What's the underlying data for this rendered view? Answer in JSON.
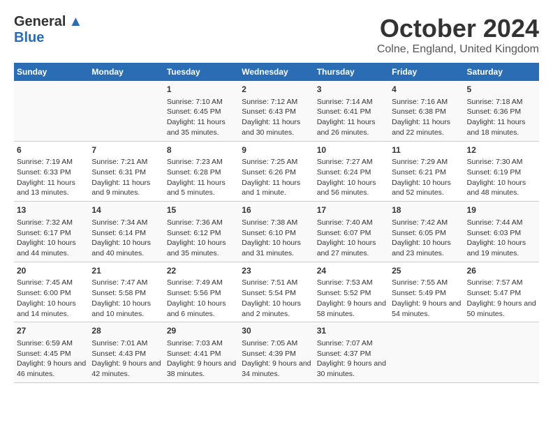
{
  "header": {
    "logo_general": "General",
    "logo_blue": "Blue",
    "month_title": "October 2024",
    "location": "Colne, England, United Kingdom"
  },
  "days_of_week": [
    "Sunday",
    "Monday",
    "Tuesday",
    "Wednesday",
    "Thursday",
    "Friday",
    "Saturday"
  ],
  "weeks": [
    [
      {
        "day": "",
        "sunrise": "",
        "sunset": "",
        "daylight": ""
      },
      {
        "day": "",
        "sunrise": "",
        "sunset": "",
        "daylight": ""
      },
      {
        "day": "1",
        "sunrise": "Sunrise: 7:10 AM",
        "sunset": "Sunset: 6:45 PM",
        "daylight": "Daylight: 11 hours and 35 minutes."
      },
      {
        "day": "2",
        "sunrise": "Sunrise: 7:12 AM",
        "sunset": "Sunset: 6:43 PM",
        "daylight": "Daylight: 11 hours and 30 minutes."
      },
      {
        "day": "3",
        "sunrise": "Sunrise: 7:14 AM",
        "sunset": "Sunset: 6:41 PM",
        "daylight": "Daylight: 11 hours and 26 minutes."
      },
      {
        "day": "4",
        "sunrise": "Sunrise: 7:16 AM",
        "sunset": "Sunset: 6:38 PM",
        "daylight": "Daylight: 11 hours and 22 minutes."
      },
      {
        "day": "5",
        "sunrise": "Sunrise: 7:18 AM",
        "sunset": "Sunset: 6:36 PM",
        "daylight": "Daylight: 11 hours and 18 minutes."
      }
    ],
    [
      {
        "day": "6",
        "sunrise": "Sunrise: 7:19 AM",
        "sunset": "Sunset: 6:33 PM",
        "daylight": "Daylight: 11 hours and 13 minutes."
      },
      {
        "day": "7",
        "sunrise": "Sunrise: 7:21 AM",
        "sunset": "Sunset: 6:31 PM",
        "daylight": "Daylight: 11 hours and 9 minutes."
      },
      {
        "day": "8",
        "sunrise": "Sunrise: 7:23 AM",
        "sunset": "Sunset: 6:28 PM",
        "daylight": "Daylight: 11 hours and 5 minutes."
      },
      {
        "day": "9",
        "sunrise": "Sunrise: 7:25 AM",
        "sunset": "Sunset: 6:26 PM",
        "daylight": "Daylight: 11 hours and 1 minute."
      },
      {
        "day": "10",
        "sunrise": "Sunrise: 7:27 AM",
        "sunset": "Sunset: 6:24 PM",
        "daylight": "Daylight: 10 hours and 56 minutes."
      },
      {
        "day": "11",
        "sunrise": "Sunrise: 7:29 AM",
        "sunset": "Sunset: 6:21 PM",
        "daylight": "Daylight: 10 hours and 52 minutes."
      },
      {
        "day": "12",
        "sunrise": "Sunrise: 7:30 AM",
        "sunset": "Sunset: 6:19 PM",
        "daylight": "Daylight: 10 hours and 48 minutes."
      }
    ],
    [
      {
        "day": "13",
        "sunrise": "Sunrise: 7:32 AM",
        "sunset": "Sunset: 6:17 PM",
        "daylight": "Daylight: 10 hours and 44 minutes."
      },
      {
        "day": "14",
        "sunrise": "Sunrise: 7:34 AM",
        "sunset": "Sunset: 6:14 PM",
        "daylight": "Daylight: 10 hours and 40 minutes."
      },
      {
        "day": "15",
        "sunrise": "Sunrise: 7:36 AM",
        "sunset": "Sunset: 6:12 PM",
        "daylight": "Daylight: 10 hours and 35 minutes."
      },
      {
        "day": "16",
        "sunrise": "Sunrise: 7:38 AM",
        "sunset": "Sunset: 6:10 PM",
        "daylight": "Daylight: 10 hours and 31 minutes."
      },
      {
        "day": "17",
        "sunrise": "Sunrise: 7:40 AM",
        "sunset": "Sunset: 6:07 PM",
        "daylight": "Daylight: 10 hours and 27 minutes."
      },
      {
        "day": "18",
        "sunrise": "Sunrise: 7:42 AM",
        "sunset": "Sunset: 6:05 PM",
        "daylight": "Daylight: 10 hours and 23 minutes."
      },
      {
        "day": "19",
        "sunrise": "Sunrise: 7:44 AM",
        "sunset": "Sunset: 6:03 PM",
        "daylight": "Daylight: 10 hours and 19 minutes."
      }
    ],
    [
      {
        "day": "20",
        "sunrise": "Sunrise: 7:45 AM",
        "sunset": "Sunset: 6:00 PM",
        "daylight": "Daylight: 10 hours and 14 minutes."
      },
      {
        "day": "21",
        "sunrise": "Sunrise: 7:47 AM",
        "sunset": "Sunset: 5:58 PM",
        "daylight": "Daylight: 10 hours and 10 minutes."
      },
      {
        "day": "22",
        "sunrise": "Sunrise: 7:49 AM",
        "sunset": "Sunset: 5:56 PM",
        "daylight": "Daylight: 10 hours and 6 minutes."
      },
      {
        "day": "23",
        "sunrise": "Sunrise: 7:51 AM",
        "sunset": "Sunset: 5:54 PM",
        "daylight": "Daylight: 10 hours and 2 minutes."
      },
      {
        "day": "24",
        "sunrise": "Sunrise: 7:53 AM",
        "sunset": "Sunset: 5:52 PM",
        "daylight": "Daylight: 9 hours and 58 minutes."
      },
      {
        "day": "25",
        "sunrise": "Sunrise: 7:55 AM",
        "sunset": "Sunset: 5:49 PM",
        "daylight": "Daylight: 9 hours and 54 minutes."
      },
      {
        "day": "26",
        "sunrise": "Sunrise: 7:57 AM",
        "sunset": "Sunset: 5:47 PM",
        "daylight": "Daylight: 9 hours and 50 minutes."
      }
    ],
    [
      {
        "day": "27",
        "sunrise": "Sunrise: 6:59 AM",
        "sunset": "Sunset: 4:45 PM",
        "daylight": "Daylight: 9 hours and 46 minutes."
      },
      {
        "day": "28",
        "sunrise": "Sunrise: 7:01 AM",
        "sunset": "Sunset: 4:43 PM",
        "daylight": "Daylight: 9 hours and 42 minutes."
      },
      {
        "day": "29",
        "sunrise": "Sunrise: 7:03 AM",
        "sunset": "Sunset: 4:41 PM",
        "daylight": "Daylight: 9 hours and 38 minutes."
      },
      {
        "day": "30",
        "sunrise": "Sunrise: 7:05 AM",
        "sunset": "Sunset: 4:39 PM",
        "daylight": "Daylight: 9 hours and 34 minutes."
      },
      {
        "day": "31",
        "sunrise": "Sunrise: 7:07 AM",
        "sunset": "Sunset: 4:37 PM",
        "daylight": "Daylight: 9 hours and 30 minutes."
      },
      {
        "day": "",
        "sunrise": "",
        "sunset": "",
        "daylight": ""
      },
      {
        "day": "",
        "sunrise": "",
        "sunset": "",
        "daylight": ""
      }
    ]
  ]
}
